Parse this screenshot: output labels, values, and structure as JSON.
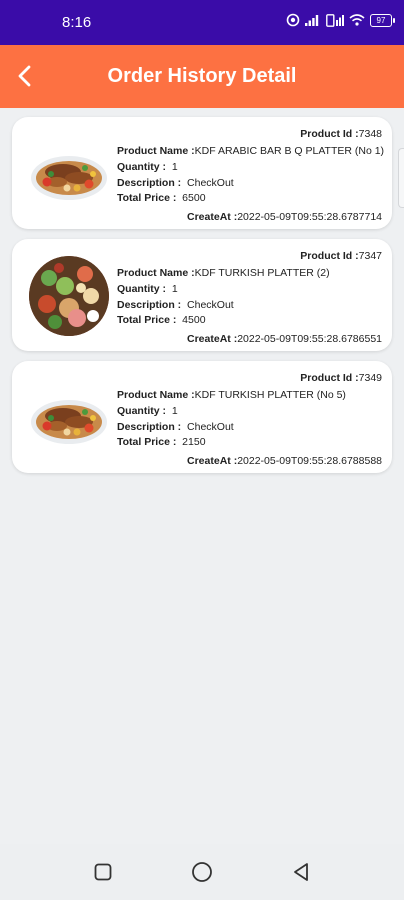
{
  "status_bar": {
    "time": "8:16",
    "battery": "97",
    "icons": [
      "location-icon",
      "signal-icon",
      "sim-signal-icon",
      "wifi-icon",
      "battery-icon"
    ]
  },
  "app_bar": {
    "title": "Order History Detail",
    "back_icon": "back-arrow-icon",
    "background": "#fd7142"
  },
  "labels": {
    "product_id": "Product Id :",
    "product_name": "Product Name :",
    "quantity": "Quantity :",
    "description": "Description :",
    "total_price": "Total Price :",
    "create_at": "CreateAt :"
  },
  "orders": [
    {
      "product_id": "7348",
      "product_name": "KDF ARABIC BAR B Q PLATTER (No 1)",
      "quantity": "1",
      "description": "CheckOut",
      "total_price": "6500",
      "created_at": "2022-05-09T09:55:28.6787714",
      "image": "bbq-platter-image"
    },
    {
      "product_id": "7347",
      "product_name": "KDF TURKISH PLATTER (2)",
      "quantity": "1",
      "description": "CheckOut",
      "total_price": "4500",
      "created_at": "2022-05-09T09:55:28.6786551",
      "image": "turkish-salad-platter-image"
    },
    {
      "product_id": "7349",
      "product_name": "KDF TURKISH PLATTER (No 5)",
      "quantity": "1",
      "description": "CheckOut",
      "total_price": "2150",
      "created_at": "2022-05-09T09:55:28.6788588",
      "image": "bbq-platter-image"
    }
  ],
  "nav_bar": [
    "recent-apps-icon",
    "home-icon",
    "back-icon"
  ]
}
